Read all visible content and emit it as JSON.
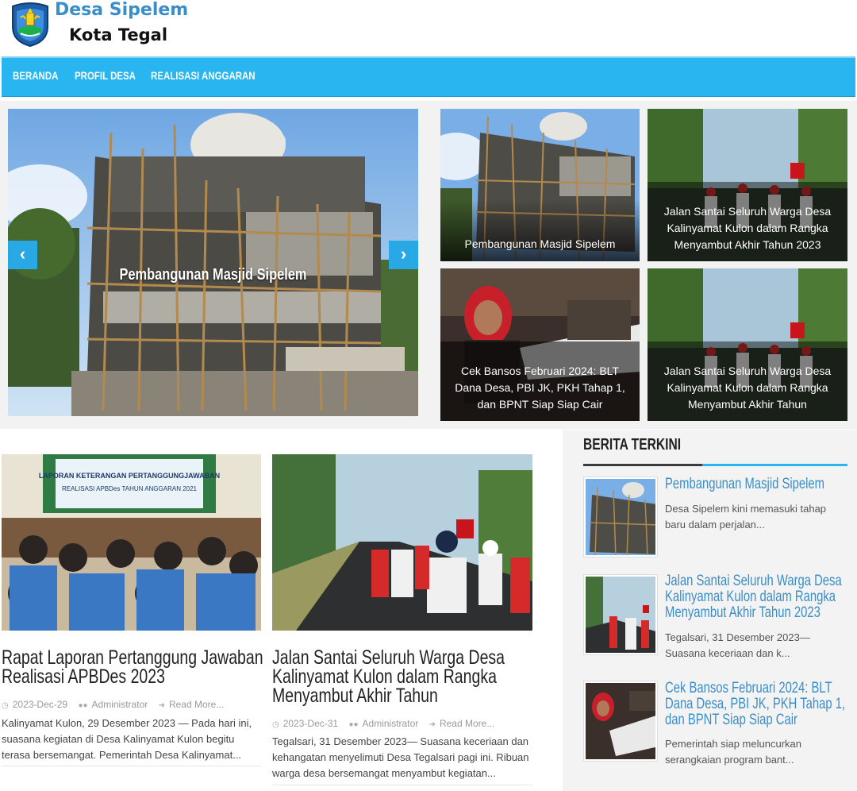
{
  "site": {
    "name": "Desa Sipelem",
    "subtitle": "Kota Tegal"
  },
  "nav": {
    "items": [
      {
        "label": "BERANDA"
      },
      {
        "label": "PROFIL DESA"
      },
      {
        "label": "REALISASI ANGGARAN"
      }
    ]
  },
  "slider": {
    "title": "Pembangunan Masjid Sipelem",
    "prev_icon": "chevron-left-icon",
    "next_icon": "chevron-right-icon"
  },
  "tiles": [
    {
      "caption": "Pembangunan Masjid Sipelem"
    },
    {
      "caption": "Jalan Santai Seluruh Warga Desa Kalinyamat Kulon dalam Rangka Menyambut Akhir Tahun 2023"
    },
    {
      "caption": "Cek Bansos Februari 2024: BLT Dana Desa, PBI JK, PKH Tahap 1, dan BPNT Siap Siap Cair"
    },
    {
      "caption": "Jalan Santai Seluruh Warga Desa Kalinyamat Kulon dalam Rangka Menyambut Akhir Tahun"
    }
  ],
  "articles": [
    {
      "title_line1": "Rapat Laporan Pertanggung Jawaban",
      "title_line2": "Realisasi APBDes 2023",
      "date": "2023-Dec-29",
      "author": "Administrator",
      "more": "Read More...",
      "excerpt": "Kalinyamat Kulon, 29 Desember 2023 — Pada hari ini, suasana kegiatan di Desa Kalinyamat Kulon begitu terasa bersemangat. Pemerintah Desa Kalinyamat...",
      "banner_line1": "LAPORAN KETERANGAN PERTANGGUNGJAWABAN",
      "banner_line2": "REALISASI APBDes TAHUN ANGGARAN 2021"
    },
    {
      "title_line1": "Jalan Santai Seluruh Warga Desa",
      "title_line2": "Kalinyamat Kulon dalam Rangka",
      "title_line3": "Menyambut Akhir Tahun",
      "date": "2023-Dec-31",
      "author": "Administrator",
      "more": "Read More...",
      "excerpt": "Tegalsari, 31 Desember 2023— Suasana keceriaan dan kehangatan menyelimuti Desa Tegalsari pagi ini. Ribuan warga desa bersemangat menyambut kegiatan..."
    }
  ],
  "sidebar": {
    "heading": "BERITA TERKINI",
    "items": [
      {
        "title_lines": [
          "Pembangunan Masjid Sipelem"
        ],
        "excerpt": "Desa Sipelem kini memasuki tahap baru dalam perjalan..."
      },
      {
        "title_lines": [
          "Jalan Santai Seluruh Warga Desa",
          "Kalinyamat Kulon dalam Rangka",
          "Menyambut Akhir Tahun 2023"
        ],
        "excerpt": "Tegalsari, 31 Desember 2023— Suasana keceriaan dan k..."
      },
      {
        "title_lines": [
          "Cek Bansos Februari 2024: BLT",
          "Dana Desa, PBI JK, PKH Tahap 1,",
          "dan BPNT Siap Siap Cair"
        ],
        "excerpt": "Pemerintah siap meluncurkan serangkaian program bant..."
      }
    ]
  },
  "colors": {
    "nav_bg": "#29b6f0",
    "brand_blue": "#3a8ec8",
    "accent": "#29a8e6"
  }
}
